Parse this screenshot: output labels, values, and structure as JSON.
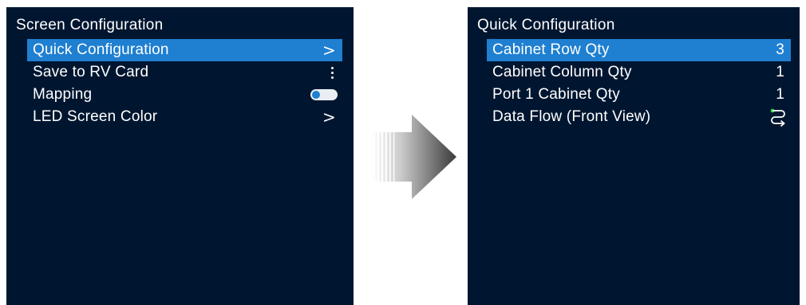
{
  "left": {
    "title": "Screen Configuration",
    "items": [
      {
        "label": "Quick Configuration",
        "suffix": ">"
      },
      {
        "label": "Save to RV Card",
        "suffix_icon": "more-vertical-icon"
      },
      {
        "label": "Mapping",
        "toggle_state": "off"
      },
      {
        "label": "LED Screen Color",
        "suffix": ">"
      }
    ]
  },
  "right": {
    "title": "Quick Configuration",
    "items": [
      {
        "label": "Cabinet Row Qty",
        "value": "3"
      },
      {
        "label": "Cabinet Column Qty",
        "value": "1"
      },
      {
        "label": "Port 1 Cabinet Qty",
        "value": "1"
      },
      {
        "label": "Data Flow (Front View)",
        "suffix_icon": "data-flow-icon"
      }
    ]
  },
  "colors": {
    "screen_bg": "#001630",
    "selected": "#1f7fd0",
    "text": "#ffffff",
    "flow_dot": "#2ecc40"
  }
}
